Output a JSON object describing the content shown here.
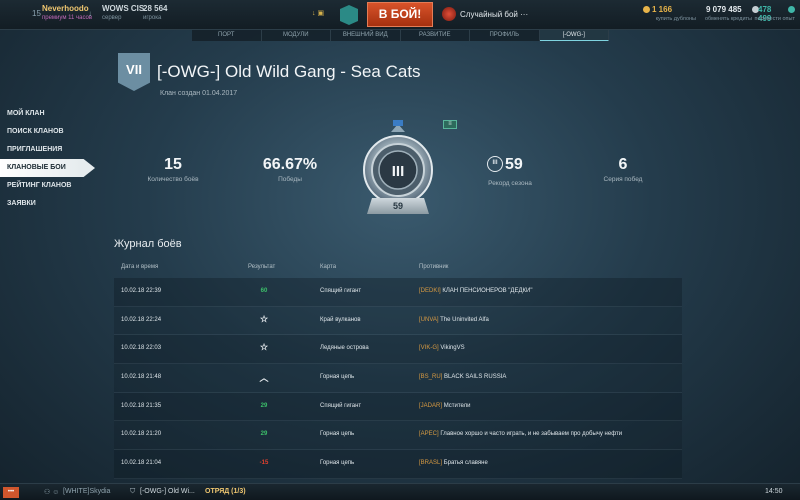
{
  "topbar": {
    "level": "15",
    "username": "Neverhoodo",
    "premium": "премиум 11 часов",
    "server_name": "WOWS CIS",
    "server_label": "сервер",
    "online_count": "28 564",
    "online_label": "игрока",
    "battle_button": "В БОЙ!",
    "battle_mode": "Случайный бой ···",
    "doubloons": "1 166",
    "doubloons_label": "купить дублоны",
    "credits": "9 079 485",
    "credits_label": "обменять кредиты",
    "free_xp": "478 499",
    "free_xp_label": "перевести опыт",
    "colors": {
      "doubloons": "#e8b44a",
      "credits": "#e4eaee",
      "free_xp": "#3fb6a8"
    }
  },
  "tabs": [
    {
      "label": "ПОРТ",
      "active": false
    },
    {
      "label": "МОДУЛИ",
      "active": false
    },
    {
      "label": "ВНЕШНИЙ ВИД",
      "active": false
    },
    {
      "label": "РАЗВИТИЕ",
      "active": false
    },
    {
      "label": "ПРОФИЛЬ",
      "active": false
    },
    {
      "label": "[-OWG-]",
      "active": true
    }
  ],
  "sidebar": {
    "items": [
      {
        "label": "МОЙ КЛАН",
        "active": false
      },
      {
        "label": "ПОИСК КЛАНОВ",
        "active": false
      },
      {
        "label": "ПРИГЛАШЕНИЯ",
        "active": false
      },
      {
        "label": "КЛАНОВЫЕ БОИ",
        "active": true
      },
      {
        "label": "РЕЙТИНГ КЛАНОВ",
        "active": false
      },
      {
        "label": "ЗАЯВКИ",
        "active": false
      }
    ]
  },
  "clan": {
    "badge": "VII",
    "title": "[-OWG-] Old Wild Gang - Sea Cats",
    "created": "Клан создан 01.04.2017"
  },
  "stats": {
    "battles": {
      "value": "15",
      "label": "Количество боёв"
    },
    "wins": {
      "value": "66.67%",
      "label": "Победы"
    },
    "record": {
      "value": "59",
      "icon_text": "III",
      "label": "Рекорд сезона"
    },
    "streak": {
      "value": "6",
      "label": "Серия побед"
    },
    "league_division": "III",
    "league_rating": "59"
  },
  "journal": {
    "title": "Журнал боёв",
    "headers": {
      "date": "Дата и время",
      "result": "Результат",
      "map": "Карта",
      "opponent": "Противник"
    },
    "rows": [
      {
        "date": "10.02.18 22:39",
        "result": "60",
        "result_kind": "win",
        "map": "Спящий гигант",
        "tag": "[DEDKI]",
        "opponent": "КЛАН ПЕНСИОНЕРОВ \"ДЕДКИ\""
      },
      {
        "date": "10.02.18 22:24",
        "result": "",
        "result_kind": "star-icon",
        "map": "Край вулканов",
        "tag": "[UNVA]",
        "opponent": "The Uninvited Alfa"
      },
      {
        "date": "10.02.18 22:03",
        "result": "",
        "result_kind": "star-icon",
        "map": "Ледяные острова",
        "tag": "[VIK-G]",
        "opponent": "VikingVS"
      },
      {
        "date": "10.02.18 21:48",
        "result": "",
        "result_kind": "chevron-icon",
        "map": "Горная цепь",
        "tag": "[BS_RU]",
        "opponent": "BLACK SAILS RUSSIA"
      },
      {
        "date": "10.02.18 21:35",
        "result": "29",
        "result_kind": "win",
        "map": "Спящий гигант",
        "tag": "[JADAR]",
        "opponent": "Мстители"
      },
      {
        "date": "10.02.18 21:20",
        "result": "29",
        "result_kind": "win",
        "map": "Горная цепь",
        "tag": "[APEC]",
        "opponent": "Главное хоршо и часто играть, и не забываем про добычу нефти"
      },
      {
        "date": "10.02.18 21:04",
        "result": "-15",
        "result_kind": "loss",
        "map": "Горная цепь",
        "tag": "[BRASL]",
        "opponent": "Братья славяне"
      }
    ]
  },
  "bottombar": {
    "menu": "•••",
    "chat1": "[WHITE]Skydia",
    "chat2": "[-OWG-] Old Wi...",
    "squad": "ОТРЯД (1/3)",
    "clock": "14:50"
  }
}
